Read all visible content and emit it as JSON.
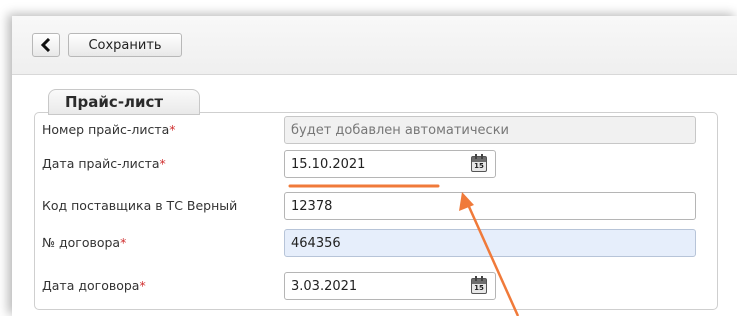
{
  "toolbar": {
    "back_icon": "chevron-left-icon",
    "save_label": "Сохранить"
  },
  "section": {
    "title": "Прайс-лист"
  },
  "fields": [
    {
      "label": "Номер прайс-листа",
      "required": "*",
      "value": "будет добавлен автоматически",
      "state": "readonly"
    },
    {
      "label": "Дата прайс-листа",
      "required": "*",
      "value": "15.10.2021",
      "icon": "calendar-icon",
      "icon_text": "15"
    },
    {
      "label": "Код поставщика в ТС Верный",
      "required": "",
      "value": "12378"
    },
    {
      "label": "№ договора",
      "required": "*",
      "value": "464356",
      "state": "highlighted"
    },
    {
      "label": "Дата договора",
      "required": "*",
      "value": "3.03.2021",
      "icon": "calendar-icon",
      "icon_text": "15"
    }
  ],
  "colors": {
    "required": "#d03030",
    "highlight_field": "#e6eefb",
    "annotation": "#f07a3a"
  }
}
